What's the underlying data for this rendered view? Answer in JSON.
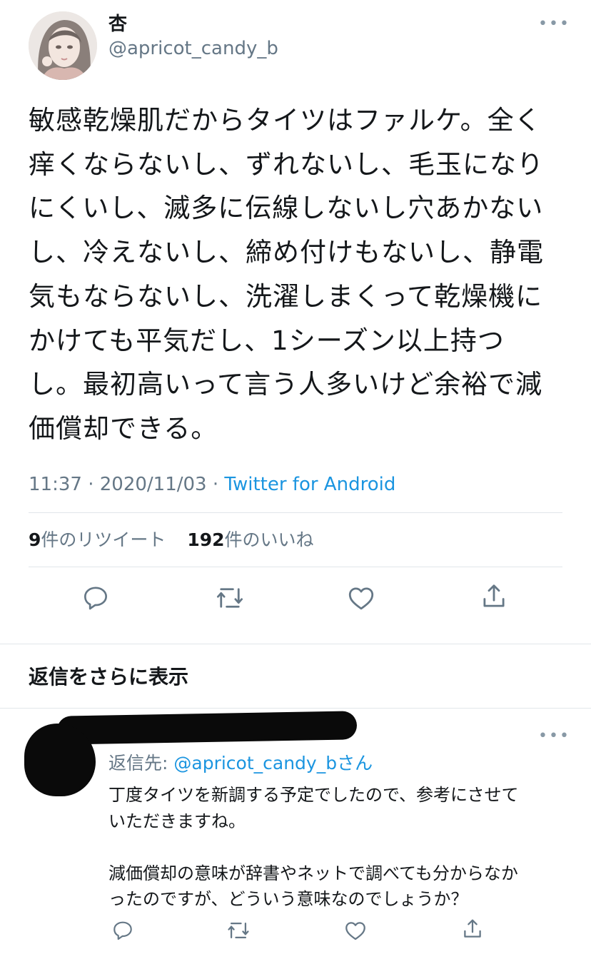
{
  "tweet": {
    "name": "杏",
    "handle": "@apricot_candy_b",
    "more": "•••",
    "text": "敏感乾燥肌だからタイツはファルケ。全く\n痒くならないし、ずれないし、毛玉になり\nにくいし、滅多に伝線しないし穴あかない\nし、冷えないし、締め付けもないし、静電\n気もならないし、洗濯しまくって乾燥機に\nかけても平気だし、1シーズン以上持つ\nし。最初高いって言う人多いけど余裕で減\n価償却できる。",
    "time": "11:37",
    "date": "2020/11/03",
    "separator": " · ",
    "source": "Twitter for Android",
    "retweet_count": "9",
    "retweet_label": "件のリツイート",
    "like_count": "192",
    "like_label": "件のいいね"
  },
  "icons": {
    "reply": "reply-icon",
    "retweet": "retweet-icon",
    "like": "heart-icon",
    "share": "share-icon"
  },
  "more_replies": {
    "title": "返信をさらに表示"
  },
  "reply": {
    "more": "•••",
    "reply_to_prefix": "返信先: ",
    "reply_to_handle": "@apricot_candy_b",
    "reply_to_suffix": "さん",
    "text": "丁度タイツを新調する予定でしたので、参考にさせて\nいただきますね。\n\n減価償却の意味が辞書やネットで調べても分からなか\nったのですが、どういう意味なのでしょうか？"
  },
  "colors": {
    "text": "#14171a",
    "secondary": "#657786",
    "link": "#1b95e0",
    "divider": "#e1e6ea",
    "redaction": "#0a0a0a"
  }
}
